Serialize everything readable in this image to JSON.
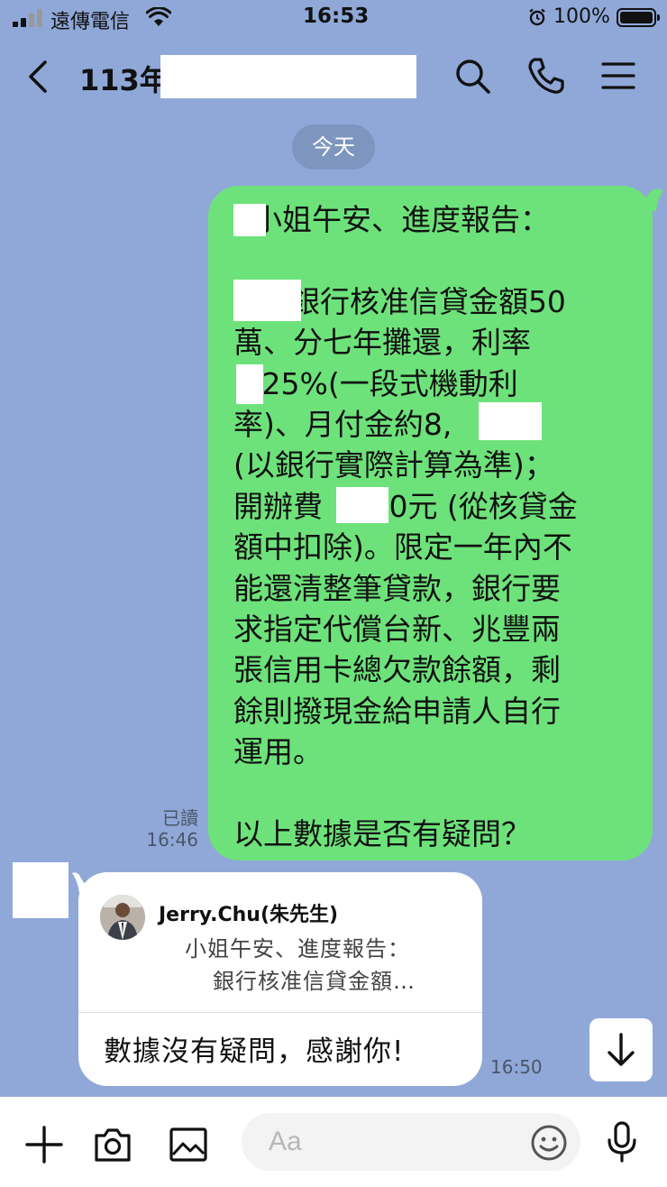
{
  "status_bar": {
    "carrier": "遠傳電信",
    "time": "16:53",
    "battery": "100%"
  },
  "header": {
    "title": "113年"
  },
  "date_divider": "今天",
  "sent_message": {
    "lines": [
      "  小姐午安、進度報告：",
      "",
      "      銀行核准信貸金額50",
      "萬、分七年攤還，利率",
      "  .25%(一段式機動利",
      "率)、月付金約8,      元",
      "(以銀行實際計算為準)；",
      "開辦費     00元 (從核貸金",
      "額中扣除)。限定一年內不",
      "能還清整筆貸款，銀行要",
      "求指定代償台新、兆豐兩",
      "張信用卡總欠款餘額，剩",
      "餘則撥現金給申請人自行",
      "運用。",
      "",
      "以上數據是否有疑問？"
    ],
    "read_status": "已讀",
    "time": "16:46"
  },
  "received_message": {
    "quote_sender": "Jerry.Chu(朱先生)",
    "quote_line1": "小姐午安、進度報告：",
    "quote_line2": "銀行核准信貸金額…",
    "text": "數據沒有疑問，感謝你!",
    "time": "16:50"
  },
  "input": {
    "placeholder": "Aa"
  }
}
